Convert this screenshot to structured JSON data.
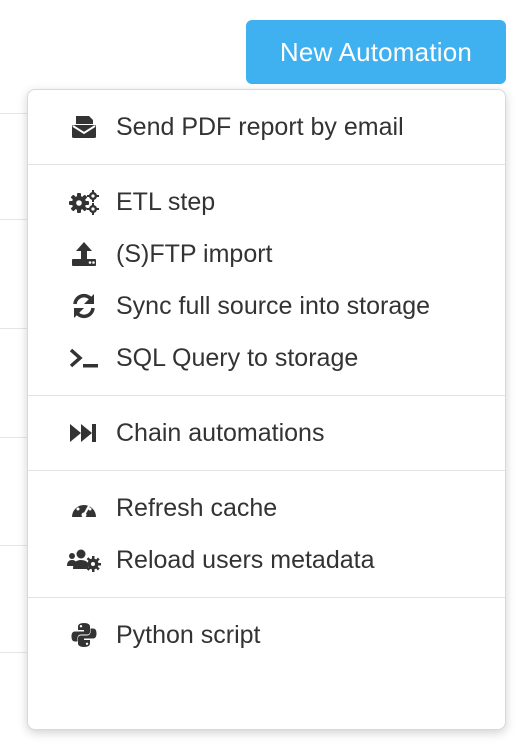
{
  "header": {
    "new_automation_label": "New Automation"
  },
  "menu": {
    "sections": [
      {
        "items": [
          {
            "label": "Send PDF report by email",
            "icon": "email-report-icon"
          }
        ]
      },
      {
        "items": [
          {
            "label": "ETL step",
            "icon": "gears-icon"
          },
          {
            "label": "(S)FTP import",
            "icon": "upload-icon"
          },
          {
            "label": "Sync full source into storage",
            "icon": "sync-icon"
          },
          {
            "label": "SQL Query to storage",
            "icon": "terminal-icon"
          }
        ]
      },
      {
        "items": [
          {
            "label": "Chain automations",
            "icon": "fast-forward-icon"
          }
        ]
      },
      {
        "items": [
          {
            "label": "Refresh cache",
            "icon": "dashboard-icon"
          },
          {
            "label": "Reload users metadata",
            "icon": "users-cog-icon"
          }
        ]
      },
      {
        "items": [
          {
            "label": "Python script",
            "icon": "python-icon"
          }
        ]
      }
    ]
  },
  "colors": {
    "button": "#3fb1f0",
    "text": "#333333",
    "divider": "#e3e3e3"
  }
}
